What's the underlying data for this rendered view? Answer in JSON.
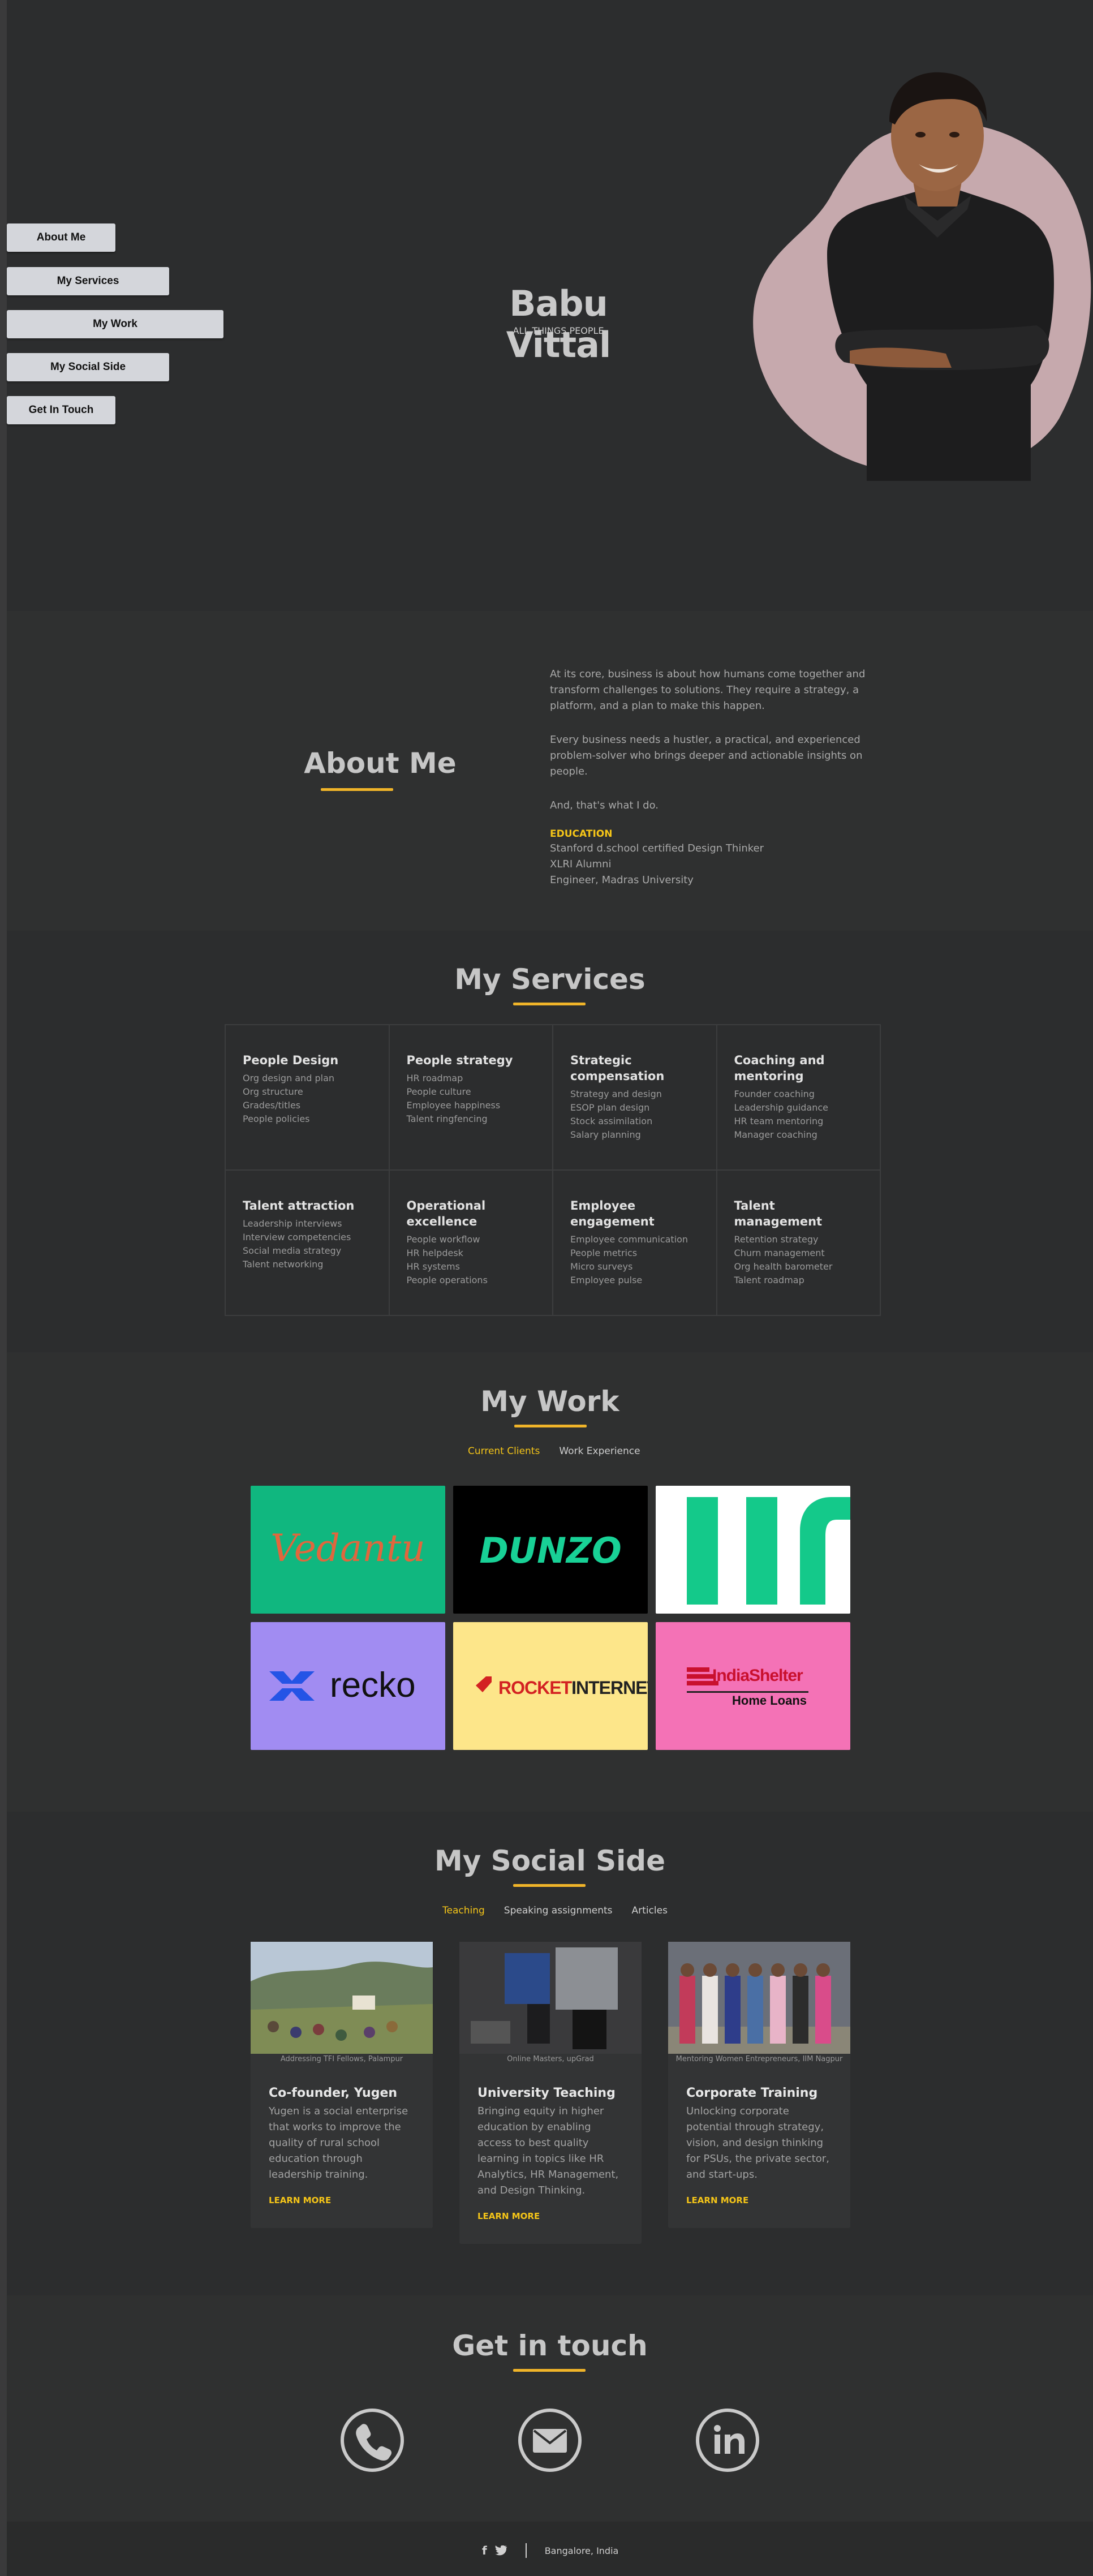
{
  "hero": {
    "name": "Babu Vittal",
    "tagline": "ALL THINGS PEOPLE",
    "nav": [
      "About Me",
      "My Services",
      "My Work",
      "My Social Side",
      "Get In Touch"
    ]
  },
  "about": {
    "heading": "About Me",
    "paragraphs": [
      "At its core, business is about how humans come together and transform challenges to solutions. They require a strategy, a platform, and a plan to make this happen.",
      "Every business needs a hustler, a practical, and experienced problem-solver who brings deeper and actionable insights on people.",
      "And, that's what I do."
    ],
    "education_title": "EDUCATION",
    "education": [
      "Stanford d.school certified Design Thinker",
      "XLRI Alumni",
      "Engineer, Madras University"
    ]
  },
  "services": {
    "heading": "My Services",
    "items": [
      {
        "title": "People Design",
        "points": [
          "Org design and plan",
          "Org structure",
          "Grades/titles",
          "People policies"
        ]
      },
      {
        "title": "People strategy",
        "points": [
          "HR roadmap",
          "People culture",
          "Employee happiness",
          "Talent ringfencing"
        ]
      },
      {
        "title": "Strategic compensation",
        "points": [
          "Strategy and design",
          "ESOP plan design",
          "Stock assimilation",
          "Salary planning"
        ]
      },
      {
        "title": "Coaching and mentoring",
        "points": [
          "Founder coaching",
          "Leadership guidance",
          "HR team mentoring",
          "Manager coaching"
        ]
      },
      {
        "title": "Talent attraction",
        "points": [
          "Leadership interviews",
          "Interview competencies",
          "Social media strategy",
          "Talent networking"
        ]
      },
      {
        "title": "Operational excellence",
        "points": [
          "People workflow",
          "HR helpdesk",
          "HR systems",
          "People operations"
        ]
      },
      {
        "title": "Employee engagement",
        "points": [
          "Employee communication",
          "People metrics",
          "Micro surveys",
          "Employee pulse"
        ]
      },
      {
        "title": "Talent management",
        "points": [
          "Retention strategy",
          "Churn management",
          "Org health barometer",
          "Talent roadmap"
        ]
      }
    ]
  },
  "work": {
    "heading": "My Work",
    "tabs": [
      "Current Clients",
      "Work Experience"
    ],
    "logos": {
      "vedantu": "Vedantu",
      "dunzo": "DUNZO",
      "recko": "recko",
      "rocket_a": "ROCKET",
      "rocket_b": "INTERNET",
      "indiashelter_a": "IndiaShelter",
      "indiashelter_b": "Home Loans"
    },
    "colors": {
      "vedantu_bg": "#10b77f",
      "dunzo_bg": "#000000",
      "recko_bg": "#a18cf2",
      "rocket_bg": "#fde68a",
      "indiashelter_bg": "#f472b6"
    }
  },
  "social": {
    "heading": "My Social Side",
    "tabs": [
      "Teaching",
      "Speaking assignments",
      "Articles"
    ],
    "cards": [
      {
        "caption": "Addressing TFI Fellows, Palampur",
        "title": "Co-founder, Yugen",
        "desc": "Yugen is a social enterprise that works to improve the quality of rural school education through leadership training.",
        "cta": "LEARN MORE"
      },
      {
        "caption": "Online Masters, upGrad",
        "title": "University Teaching",
        "desc": "Bringing equity in higher education by enabling access to best quality learning in topics like HR Analytics, HR Management, and Design Thinking.",
        "cta": "LEARN MORE"
      },
      {
        "caption": "Mentoring Women Entrepreneurs, IIM Nagpur",
        "title": "Corporate Training",
        "desc": "Unlocking corporate potential through strategy, vision, and design thinking for PSUs, the private sector, and start-ups.",
        "cta": "LEARN MORE"
      }
    ]
  },
  "contact": {
    "heading": "Get in touch",
    "icons": [
      "phone-icon",
      "mail-icon",
      "linkedin-icon"
    ]
  },
  "footer": {
    "location": "Bangalore, India",
    "fb": "f"
  },
  "accent": "#f5c518"
}
